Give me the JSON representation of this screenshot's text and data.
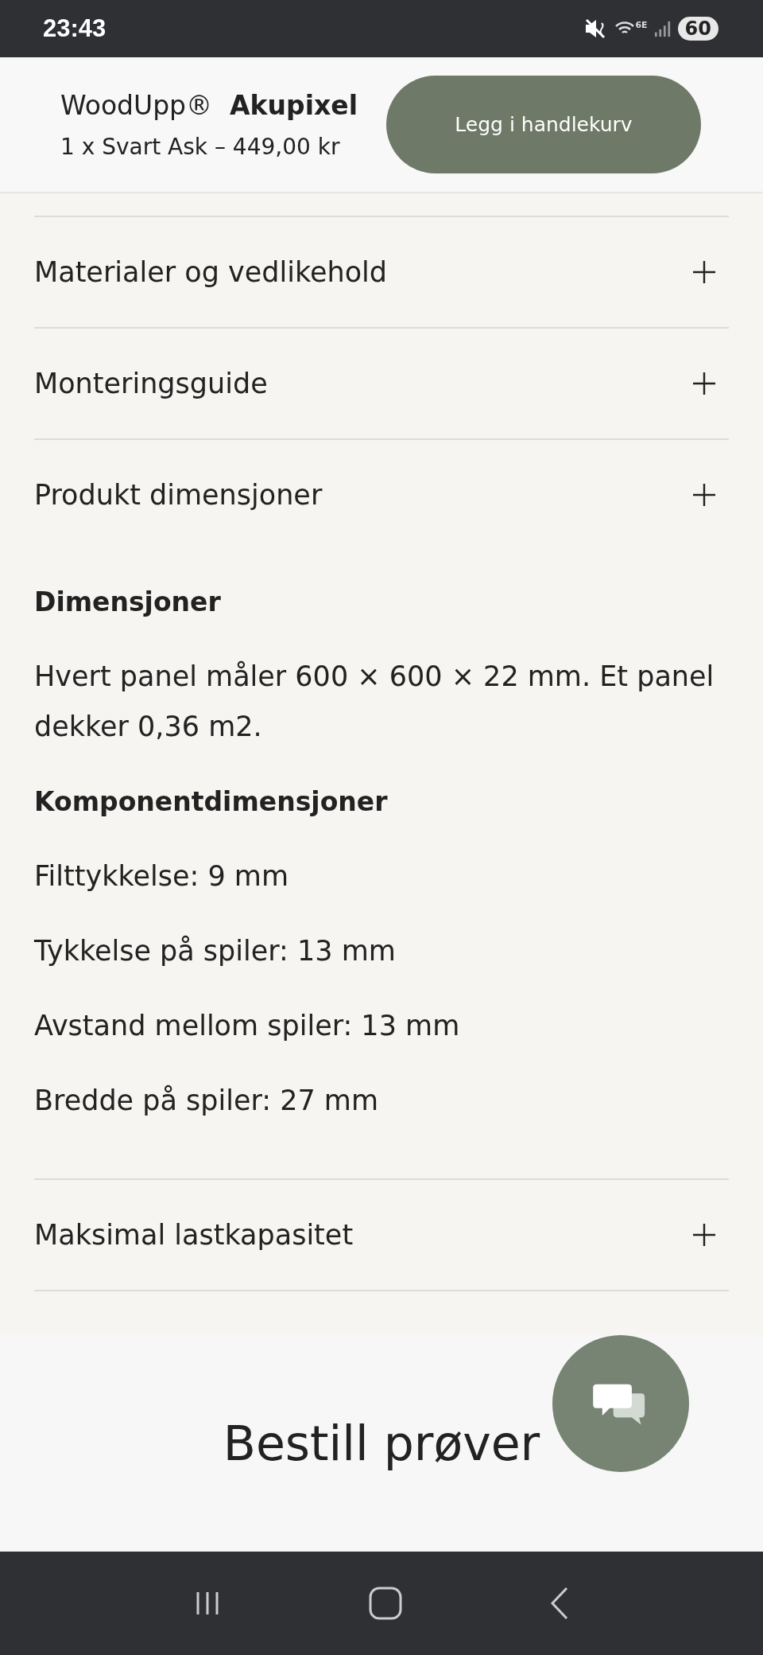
{
  "status_bar": {
    "time": "23:43",
    "wifi_label": "6E",
    "battery": "60"
  },
  "sticky_header": {
    "brand": "WoodUpp®",
    "product": "Akupixel",
    "variant": "1 x Svart Ask – 449,00 kr",
    "button": "Legg i handlekurv"
  },
  "accordions": [
    {
      "title": "Materialer og vedlikehold"
    },
    {
      "title": "Monteringsguide"
    },
    {
      "title": "Produkt dimensjoner",
      "content": [
        {
          "kind": "heading",
          "text": "Dimensjoner"
        },
        {
          "kind": "paragraph",
          "text": "Hvert panel måler 600 × 600 × 22 mm. Et panel dekker 0,36 m2."
        },
        {
          "kind": "heading",
          "text": "Komponentdimensjoner"
        },
        {
          "kind": "paragraph",
          "text": "Filttykkelse: 9 mm"
        },
        {
          "kind": "paragraph",
          "text": "Tykkelse på spiler: 13 mm"
        },
        {
          "kind": "paragraph",
          "text": "Avstand mellom spiler: 13 mm"
        },
        {
          "kind": "paragraph",
          "text": "Bredde på spiler: 27 mm"
        }
      ]
    },
    {
      "title": "Maksimal lastkapasitet"
    }
  ],
  "samples_section": {
    "title": "Bestill prøver"
  }
}
